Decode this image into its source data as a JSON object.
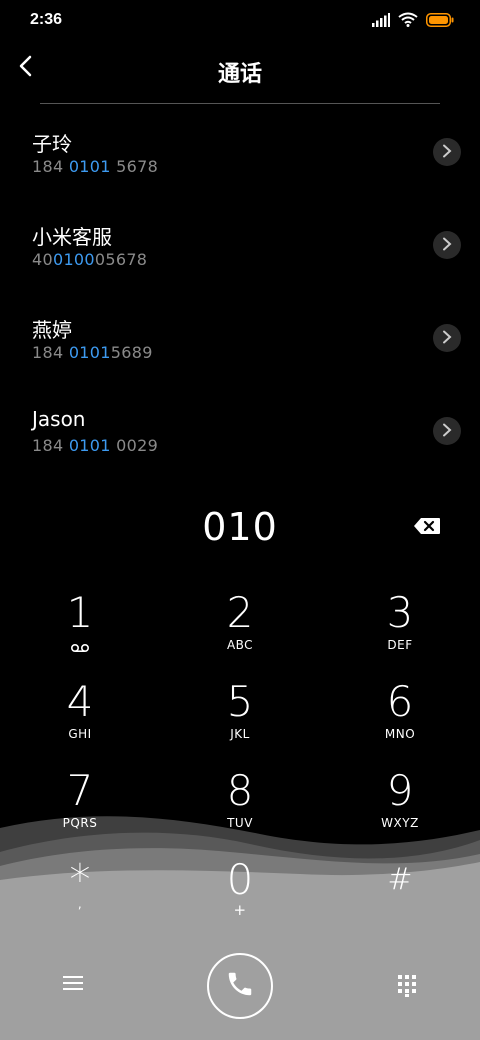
{
  "status_bar": {
    "time": "2:36",
    "icons": [
      "signal-icon",
      "wifi-icon",
      "battery-icon"
    ],
    "battery_color": "#ff9500"
  },
  "header": {
    "title": "通话",
    "back_icon": "back-arrow-icon"
  },
  "results": [
    {
      "name": "子玲",
      "number_pre": "184 ",
      "number_match": "0101",
      "number_post": " 5678"
    },
    {
      "name": "小米客服",
      "number_pre": "40",
      "number_match": "0100",
      "number_post": "05678"
    },
    {
      "name": "燕婷",
      "number_pre": "184 ",
      "number_match": "0101",
      "number_post": "5689"
    },
    {
      "name": "Jason",
      "number_pre": "184 ",
      "number_match": "0101",
      "number_post": " 0029"
    }
  ],
  "highlight_color": "#3d9af0",
  "dial_input": {
    "value": "010",
    "backspace_icon": "backspace-icon"
  },
  "keypad": [
    {
      "digit": "1",
      "letters": "",
      "sub_icon": "voicemail-icon"
    },
    {
      "digit": "2",
      "letters": "ABC"
    },
    {
      "digit": "3",
      "letters": "DEF"
    },
    {
      "digit": "4",
      "letters": "GHI"
    },
    {
      "digit": "5",
      "letters": "JKL"
    },
    {
      "digit": "6",
      "letters": "MNO"
    },
    {
      "digit": "7",
      "letters": "PQRS"
    },
    {
      "digit": "8",
      "letters": "TUV"
    },
    {
      "digit": "9",
      "letters": "WXYZ"
    },
    {
      "digit": "*",
      "letters": ","
    },
    {
      "digit": "0",
      "letters": "+"
    },
    {
      "digit": "#",
      "letters": ""
    }
  ],
  "bottom_bar": {
    "menu_icon": "menu-icon",
    "call_icon": "phone-icon",
    "keypad_icon": "dialpad-icon"
  }
}
